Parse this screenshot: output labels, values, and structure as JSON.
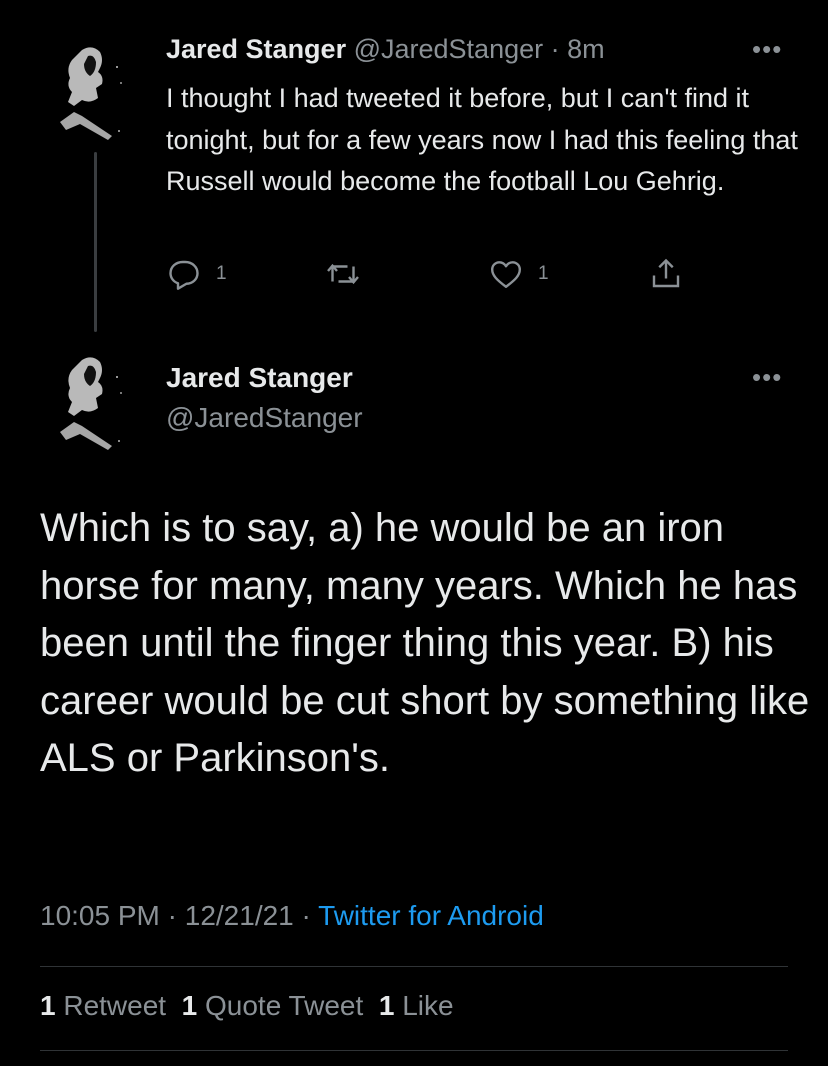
{
  "tweet1": {
    "name": "Jared Stanger",
    "handle": "@JaredStanger",
    "separator": "·",
    "time": "8m",
    "text": "I thought I had tweeted it before, but I can't find it tonight, but for a few years now I had this feeling that Russell would become the football Lou Gehrig.",
    "reply_count": "1",
    "like_count": "1",
    "more_label": "•••"
  },
  "tweet2": {
    "name": "Jared Stanger",
    "handle": "@JaredStanger",
    "more_label": "•••",
    "text": "Which is to say, a) he would be an iron horse for many, many years. Which he has been until the finger thing this year. B) his career would be cut short by something like ALS or Parkinson's.",
    "time": "10:05 PM",
    "sep1": "·",
    "date": "12/21/21",
    "sep2": "·",
    "source": "Twitter for Android",
    "stats": {
      "retweets_count": "1",
      "retweets_label": "Retweet",
      "quotes_count": "1",
      "quotes_label": "Quote Tweet",
      "likes_count": "1",
      "likes_label": "Like"
    }
  },
  "colors": {
    "background": "#000000",
    "text": "#e7e9ea",
    "muted": "#8b9196",
    "link": "#1d9bf0",
    "divider": "#2f3336"
  }
}
